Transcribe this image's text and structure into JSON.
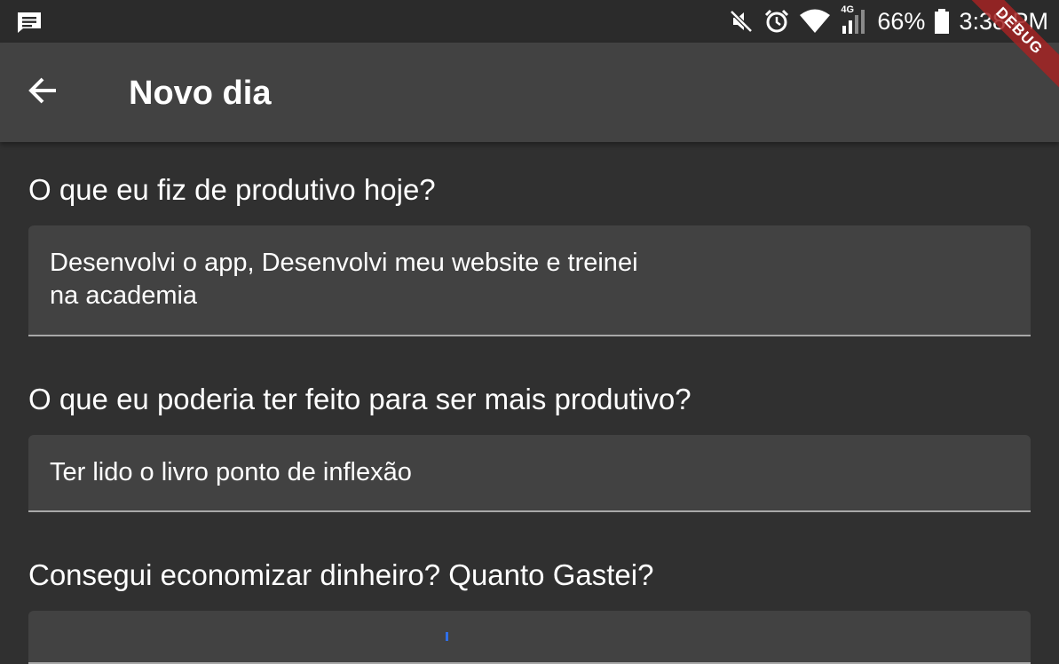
{
  "status_bar": {
    "battery_percent": "66%",
    "time": "3:38 PM",
    "network_type": "4G",
    "icons": [
      "message-icon",
      "mute-icon",
      "alarm-icon",
      "wifi-icon",
      "signal-icon",
      "battery-icon"
    ]
  },
  "app_bar": {
    "title": "Novo dia",
    "back_icon": "arrow-back-icon"
  },
  "debug_banner": "DEBUG",
  "form": {
    "q1": {
      "label": "O que eu fiz de produtivo hoje?",
      "value": "Desenvolvi o app, Desenvolvi meu website e treinei\nna academia"
    },
    "q2": {
      "label": "O que eu poderia ter feito para ser mais produtivo?",
      "value": "Ter lido o livro ponto de inflexão"
    },
    "q3": {
      "label": "Consegui economizar dinheiro? Quanto Gastei?",
      "value": ""
    }
  },
  "colors": {
    "background": "#303030",
    "app_bar": "#424242",
    "field_fill": "#424242",
    "underline": "#a8a8a8",
    "cursor": "#2f6fe8",
    "debug_ribbon": "#a32323"
  }
}
